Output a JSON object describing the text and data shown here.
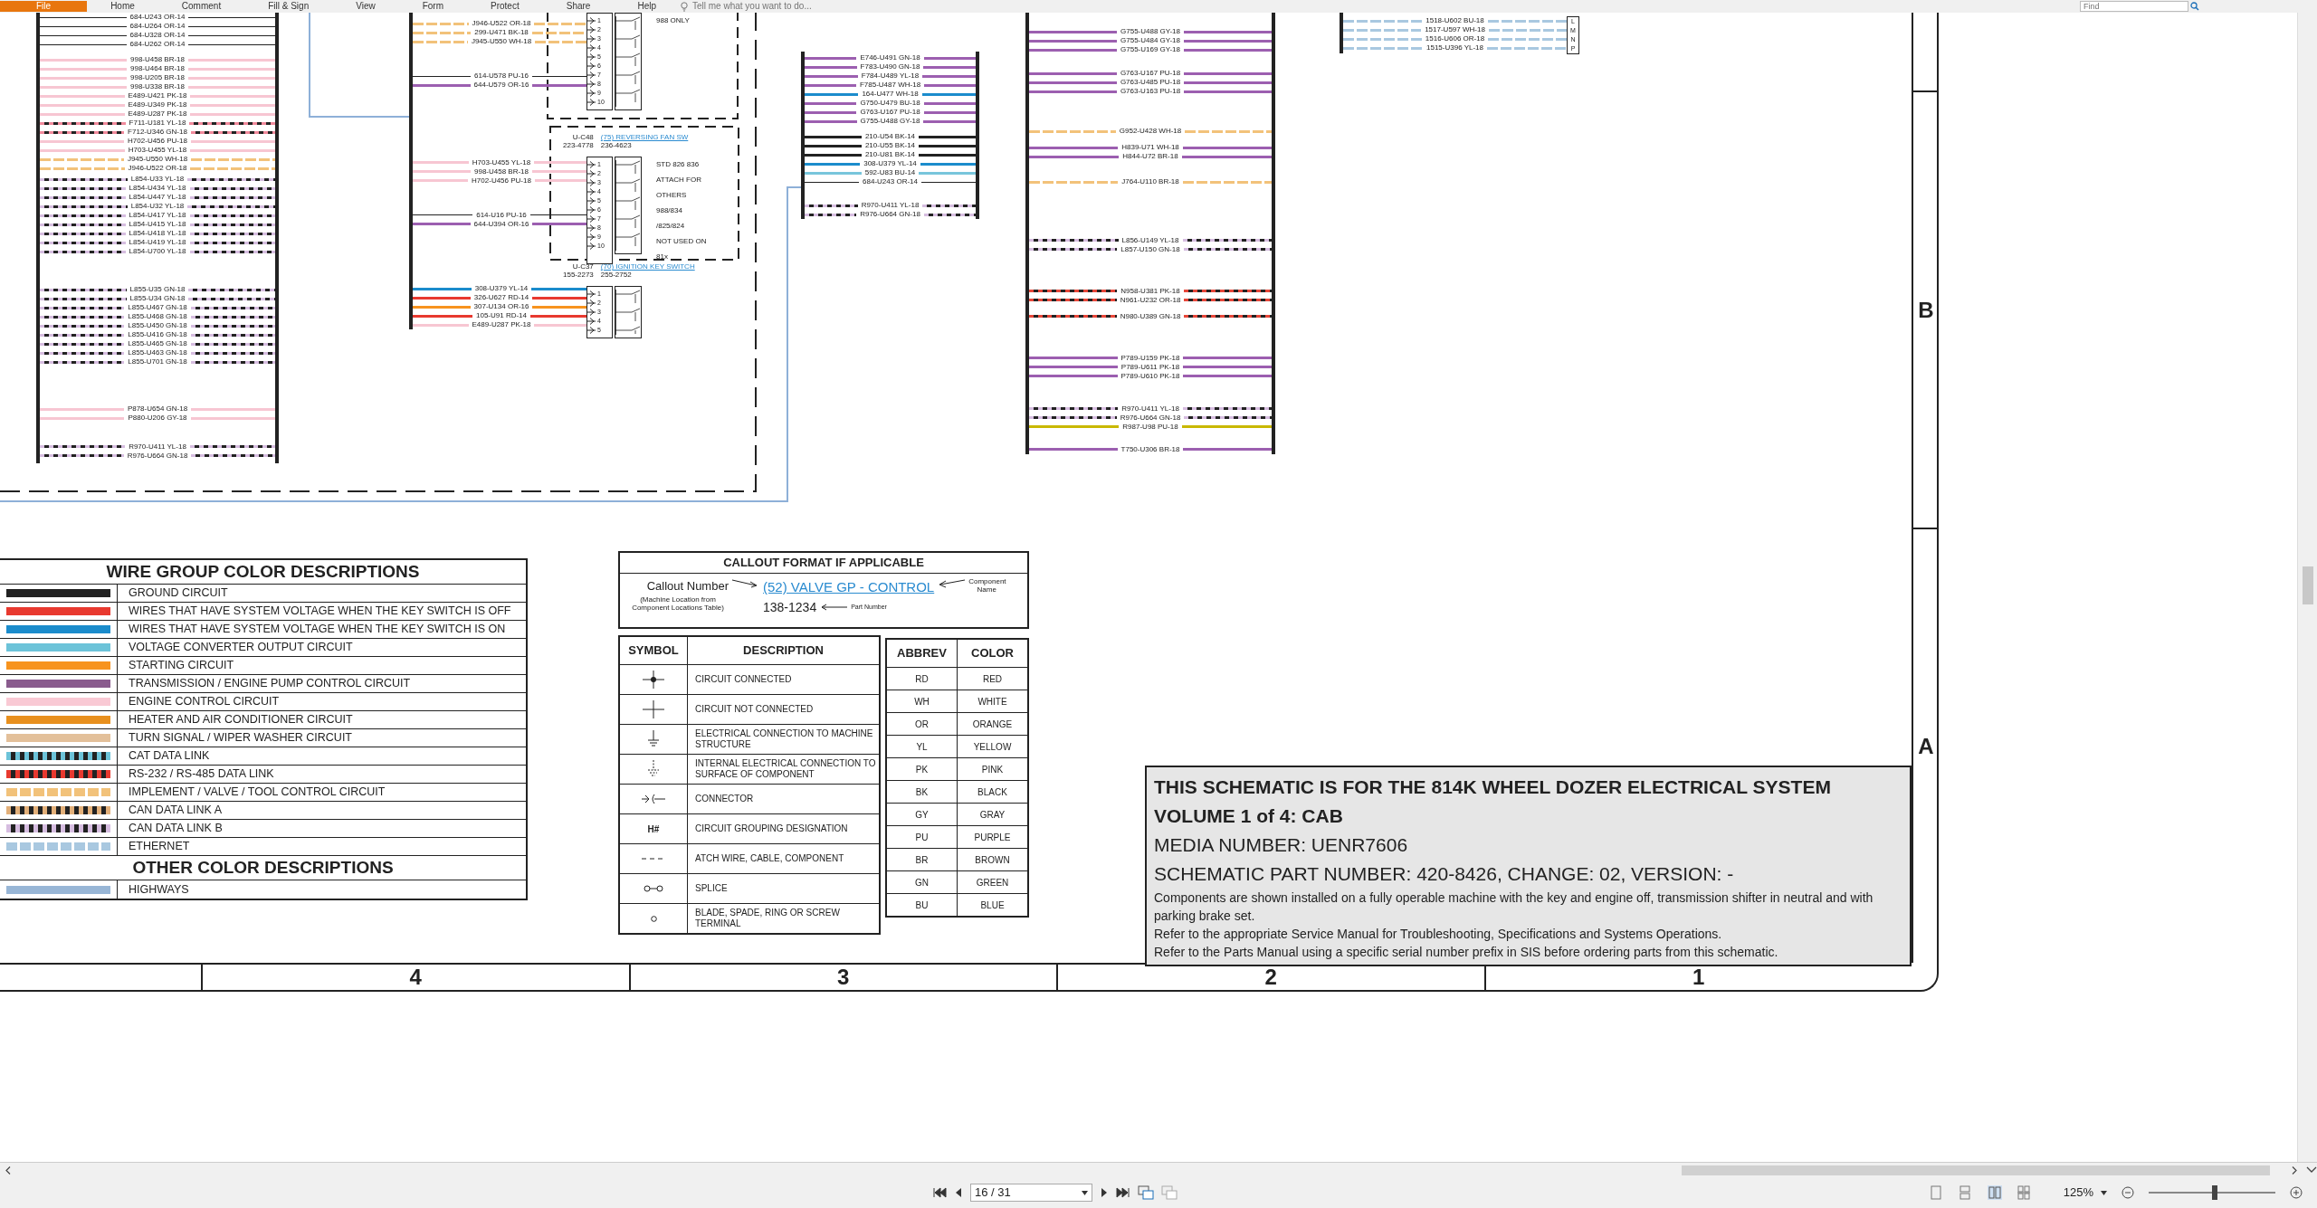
{
  "menu": [
    {
      "label": "File",
      "selected": true
    },
    {
      "label": "Home",
      "selected": false
    },
    {
      "label": "Comment",
      "selected": false
    },
    {
      "label": "Fill & Sign",
      "selected": false
    },
    {
      "label": "View",
      "selected": false
    },
    {
      "label": "Form",
      "selected": false
    },
    {
      "label": "Protect",
      "selected": false
    },
    {
      "label": "Share",
      "selected": false
    },
    {
      "label": "Help",
      "selected": false
    }
  ],
  "tell_me": {
    "placeholder": "Tell me what you want to do..."
  },
  "find": {
    "placeholder": "Find"
  },
  "schematic": {
    "bundles": [
      {
        "groups": [
          {
            "wires": [
              {
                "label": "684-U243 OR-14",
                "kind": "thin",
                "color": "#222222"
              },
              {
                "label": "684-U264 OR-14",
                "kind": "thin",
                "color": "#222222"
              },
              {
                "label": "684-U328 OR-14",
                "kind": "thin",
                "color": "#222222"
              },
              {
                "label": "684-U262 OR-14",
                "kind": "thin",
                "color": "#222222"
              }
            ]
          },
          {
            "wires": [
              {
                "label": "998-U458 BR-18",
                "kind": "solid",
                "color": "#f7c6d2"
              },
              {
                "label": "998-U464 BR-18",
                "kind": "solid",
                "color": "#f7c6d2"
              },
              {
                "label": "998-U205 BR-18",
                "kind": "solid",
                "color": "#f7c6d2"
              },
              {
                "label": "998-U338 BR-18",
                "kind": "solid",
                "color": "#f7c6d2"
              }
            ]
          },
          {
            "wires": [
              {
                "label": "E489-U421 PK-18",
                "kind": "solid",
                "color": "#f7c6d2"
              },
              {
                "label": "E489-U349 PK-18",
                "kind": "solid",
                "color": "#f7c6d2"
              },
              {
                "label": "E489-U287 PK-18",
                "kind": "solid",
                "color": "#f7c6d2"
              }
            ]
          },
          {
            "wires": [
              {
                "label": "F711-U181 YL-18",
                "kind": "striped",
                "color": "#f08a9c"
              },
              {
                "label": "F712-U346 GN-18",
                "kind": "striped",
                "color": "#f08a9c"
              },
              {
                "label": "H702-U456 PU-18",
                "kind": "solid",
                "color": "#f7c6d2"
              },
              {
                "label": "H703-U455 YL-18",
                "kind": "solid",
                "color": "#f7c6d2"
              },
              {
                "label": "J945-U550 WH-18",
                "kind": "banded",
                "color": "#f2c27a"
              },
              {
                "label": "J946-U522 OR-18",
                "kind": "banded",
                "color": "#f2c27a"
              }
            ]
          },
          {
            "wires": [
              {
                "label": "L854-U33 YL-18",
                "kind": "striped",
                "color": "#d6bde0"
              },
              {
                "label": "L854-U434 YL-18",
                "kind": "striped",
                "color": "#d6bde0"
              },
              {
                "label": "L854-U447 YL-18",
                "kind": "striped",
                "color": "#d6bde0"
              },
              {
                "label": "L854-U32 YL-18",
                "kind": "striped",
                "color": "#d6bde0"
              },
              {
                "label": "L854-U417 YL-18",
                "kind": "striped",
                "color": "#d6bde0"
              },
              {
                "label": "L854-U415 YL-18",
                "kind": "striped",
                "color": "#d6bde0"
              },
              {
                "label": "L854-U418 YL-18",
                "kind": "striped",
                "color": "#d6bde0"
              },
              {
                "label": "L854-U419 YL-18",
                "kind": "striped",
                "color": "#d6bde0"
              },
              {
                "label": "L854-U700 YL-18",
                "kind": "striped",
                "color": "#d6bde0"
              }
            ]
          },
          {
            "wires": [
              {
                "label": "L855-U35 GN-18",
                "kind": "striped",
                "color": "#d6bde0"
              },
              {
                "label": "L855-U34 GN-18",
                "kind": "striped",
                "color": "#d6bde0"
              },
              {
                "label": "L855-U467 GN-18",
                "kind": "striped",
                "color": "#d6bde0"
              },
              {
                "label": "L855-U468 GN-18",
                "kind": "striped",
                "color": "#d6bde0"
              },
              {
                "label": "L855-U450 GN-18",
                "kind": "striped",
                "color": "#d6bde0"
              },
              {
                "label": "L855-U416 GN-18",
                "kind": "striped",
                "color": "#d6bde0"
              },
              {
                "label": "L855-U465 GN-18",
                "kind": "striped",
                "color": "#d6bde0"
              },
              {
                "label": "L855-U463 GN-18",
                "kind": "striped",
                "color": "#d6bde0"
              },
              {
                "label": "L855-U701 GN-18",
                "kind": "striped",
                "color": "#d6bde0"
              }
            ]
          },
          {
            "wires": [
              {
                "label": "P878-U654 GN-18",
                "kind": "solid",
                "color": "#f7c6d2"
              },
              {
                "label": "P880-U206 GY-18",
                "kind": "solid",
                "color": "#f7c6d2"
              }
            ]
          },
          {
            "wires": [
              {
                "label": "R970-U411 YL-18",
                "kind": "striped",
                "color": "#d6bde0"
              },
              {
                "label": "R976-U664 GN-18",
                "kind": "striped",
                "color": "#d6bde0"
              }
            ]
          }
        ]
      },
      {
        "groups": [
          {
            "wires": [
              {
                "label": "J946-U522 OR-18",
                "kind": "banded",
                "color": "#f2c27a"
              },
              {
                "label": "299-U471 BK-18",
                "kind": "banded",
                "color": "#f2c27a"
              },
              {
                "label": "J945-U550 WH-18",
                "kind": "banded",
                "color": "#f2c27a"
              }
            ]
          },
          {
            "wires": [
              {
                "label": "614-U578 PU-16",
                "kind": "thin",
                "color": "#222222"
              },
              {
                "label": "644-U579 OR-16",
                "kind": "solid",
                "color": "#9c5fb0"
              }
            ]
          },
          {
            "wires": [
              {
                "label": "H703-U455 YL-18",
                "kind": "solid",
                "color": "#f7c6d2"
              },
              {
                "label": "998-U458 BR-18",
                "kind": "solid",
                "color": "#f7c6d2"
              },
              {
                "label": "H702-U456 PU-18",
                "kind": "solid",
                "color": "#f7c6d2"
              }
            ]
          },
          {
            "wires": [
              {
                "label": "614-U16 PU-16",
                "kind": "thin",
                "color": "#222222"
              },
              {
                "label": "644-U394 OR-16",
                "kind": "solid",
                "color": "#9c5fb0"
              }
            ]
          },
          {
            "wires": [
              {
                "label": "308-U379 YL-14",
                "kind": "solid",
                "color": "#1b8ccc"
              },
              {
                "label": "326-U627 RD-14",
                "kind": "solid",
                "color": "#e8392f"
              },
              {
                "label": "307-U134 OR-16",
                "kind": "solid",
                "color": "#f7931e"
              },
              {
                "label": "105-U91 RD-14",
                "kind": "solid",
                "color": "#e8392f"
              },
              {
                "label": "E489-U287 PK-18",
                "kind": "solid",
                "color": "#f7c6d2"
              }
            ]
          }
        ]
      },
      {
        "groups": [
          {
            "wires": [
              {
                "label": "E746-U491 GN-18",
                "kind": "solid",
                "color": "#9c5fb0"
              },
              {
                "label": "F783-U490 GN-18",
                "kind": "solid",
                "color": "#9c5fb0"
              },
              {
                "label": "F784-U489 YL-18",
                "kind": "solid",
                "color": "#9c5fb0"
              },
              {
                "label": "F785-U487 WH-18",
                "kind": "solid",
                "color": "#9c5fb0"
              },
              {
                "label": "164-U477 WH-18",
                "kind": "solid",
                "color": "#1b8ccc"
              },
              {
                "label": "G750-U479 BU-18",
                "kind": "solid",
                "color": "#9c5fb0"
              },
              {
                "label": "G763-U167 PU-18",
                "kind": "solid",
                "color": "#9c5fb0"
              },
              {
                "label": "G755-U488 GY-18",
                "kind": "solid",
                "color": "#9c5fb0"
              }
            ]
          },
          {
            "wires": [
              {
                "label": "210-U54 BK-14",
                "kind": "solid",
                "color": "#222222"
              },
              {
                "label": "210-U55 BK-14",
                "kind": "solid",
                "color": "#222222"
              },
              {
                "label": "210-U81 BK-14",
                "kind": "solid",
                "color": "#222222"
              },
              {
                "label": "308-U379 YL-14",
                "kind": "solid",
                "color": "#1b8ccc"
              },
              {
                "label": "592-U83 BU-14",
                "kind": "solid",
                "color": "#78c6dc"
              },
              {
                "label": "684-U243 OR-14",
                "kind": "thin",
                "color": "#222222"
              }
            ]
          },
          {
            "wires": [
              {
                "label": "R970-U411 YL-18",
                "kind": "striped",
                "color": "#d6bde0"
              },
              {
                "label": "R976-U664 GN-18",
                "kind": "striped",
                "color": "#d6bde0"
              }
            ]
          }
        ]
      },
      {
        "groups": [
          {
            "wires": [
              {
                "label": "G755-U488 GY-18",
                "kind": "solid",
                "color": "#9c5fb0"
              },
              {
                "label": "G755-U484 GY-18",
                "kind": "solid",
                "color": "#9c5fb0"
              },
              {
                "label": "G755-U169 GY-18",
                "kind": "solid",
                "color": "#9c5fb0"
              }
            ]
          },
          {
            "wires": [
              {
                "label": "G763-U167 PU-18",
                "kind": "solid",
                "color": "#9c5fb0"
              },
              {
                "label": "G763-U485 PU-18",
                "kind": "solid",
                "color": "#9c5fb0"
              },
              {
                "label": "G763-U163 PU-18",
                "kind": "solid",
                "color": "#9c5fb0"
              }
            ]
          },
          {
            "wires": [
              {
                "label": "G952-U428 WH-18",
                "kind": "banded",
                "color": "#f2c27a"
              }
            ]
          },
          {
            "wires": [
              {
                "label": "H839-U71 WH-18",
                "kind": "solid",
                "color": "#9c5fb0"
              },
              {
                "label": "H844-U72 BR-18",
                "kind": "solid",
                "color": "#9c5fb0"
              }
            ]
          },
          {
            "wires": [
              {
                "label": "J764-U110 BR-18",
                "kind": "banded",
                "color": "#f2c27a"
              }
            ]
          },
          {
            "wires": [
              {
                "label": "L856-U149 YL-18",
                "kind": "striped",
                "color": "#d6bde0"
              },
              {
                "label": "L857-U150 GN-18",
                "kind": "striped",
                "color": "#d6bde0"
              }
            ]
          },
          {
            "wires": [
              {
                "label": "N958-U381 PK-18",
                "kind": "striped",
                "color": "#e8473a"
              },
              {
                "label": "N961-U232 OR-18",
                "kind": "striped",
                "color": "#e8473a"
              }
            ]
          },
          {
            "wires": [
              {
                "label": "N980-U389 GN-18",
                "kind": "striped",
                "color": "#e8473a"
              }
            ]
          },
          {
            "wires": [
              {
                "label": "P789-U159 PK-18",
                "kind": "solid",
                "color": "#9c5fb0"
              },
              {
                "label": "P789-U611 PK-18",
                "kind": "solid",
                "color": "#9c5fb0"
              },
              {
                "label": "P789-U610 PK-18",
                "kind": "solid",
                "color": "#9c5fb0"
              }
            ]
          },
          {
            "wires": [
              {
                "label": "R970-U411 YL-18",
                "kind": "striped",
                "color": "#d6bde0"
              },
              {
                "label": "R976-U664 GN-18",
                "kind": "striped",
                "color": "#d6bde0"
              },
              {
                "label": "R987-U98 PU-18",
                "kind": "solid",
                "color": "#c9b800"
              }
            ]
          },
          {
            "wires": [
              {
                "label": "T750-U306 BR-18",
                "kind": "solid",
                "color": "#9c5fb0"
              }
            ]
          }
        ]
      },
      {
        "connector_pins": [
          "L",
          "M",
          "N",
          "P"
        ],
        "groups": [
          {
            "wires": [
              {
                "label": "1518-U602 BU-18",
                "kind": "banded",
                "color": "#a9c8e0"
              },
              {
                "label": "1517-U597 WH-18",
                "kind": "banded",
                "color": "#a9c8e0"
              },
              {
                "label": "1516-U606 OR-18",
                "kind": "banded",
                "color": "#a9c8e0"
              },
              {
                "label": "1515-U396 YL-18",
                "kind": "banded",
                "color": "#a9c8e0"
              }
            ]
          }
        ]
      }
    ],
    "components": [
      {
        "pins": [
          "1",
          "2",
          "3",
          "4",
          "5",
          "6",
          "7",
          "8",
          "9",
          "10"
        ],
        "notes": [
          "988 ONLY"
        ]
      },
      {
        "ref": "U-C48",
        "ref_number": "223-4778",
        "callout": "(75) REVERSING FAN SW",
        "part_number": "236-4623",
        "pins": [
          "1",
          "2",
          "3",
          "4",
          "5",
          "6",
          "7",
          "8",
          "9",
          "10"
        ],
        "notes": [
          "STD 826 836",
          "ATTACH FOR",
          "OTHERS",
          "988/834",
          "/825/824",
          "NOT USED ON",
          "81x"
        ]
      },
      {
        "ref": "U-C37",
        "ref_number": "155-2273",
        "callout": "(70) IGNITION KEY SWITCH",
        "part_number": "255-2752",
        "pins": [
          "1",
          "2",
          "3",
          "4",
          "5"
        ]
      }
    ],
    "zones": [
      "B",
      "A"
    ],
    "columns": [
      "4",
      "3",
      "2",
      "1"
    ]
  },
  "wire_legend": {
    "title": "WIRE GROUP COLOR DESCRIPTIONS",
    "rows": [
      {
        "label": "GROUND CIRCUIT",
        "kind": "solid",
        "color": "#222222"
      },
      {
        "label": "WIRES THAT HAVE SYSTEM VOLTAGE WHEN THE KEY SWITCH IS OFF",
        "kind": "solid",
        "color": "#e8392f"
      },
      {
        "label": "WIRES THAT HAVE SYSTEM VOLTAGE WHEN THE KEY SWITCH IS ON",
        "kind": "solid",
        "color": "#1b8ccc"
      },
      {
        "label": "VOLTAGE CONVERTER OUTPUT CIRCUIT",
        "kind": "solid",
        "color": "#6cc3d9"
      },
      {
        "label": "STARTING CIRCUIT",
        "kind": "solid",
        "color": "#f7931e"
      },
      {
        "label": "TRANSMISSION / ENGINE PUMP CONTROL CIRCUIT",
        "kind": "solid",
        "color": "#8a5c8e"
      },
      {
        "label": "ENGINE CONTROL CIRCUIT",
        "kind": "solid",
        "color": "#f9c9d4"
      },
      {
        "label": "HEATER AND AIR CONDITIONER CIRCUIT",
        "kind": "solid",
        "color": "#e8901e"
      },
      {
        "label": "TURN SIGNAL / WIPER WASHER CIRCUIT",
        "kind": "solid",
        "color": "#e3c09a"
      },
      {
        "label": "CAT DATA LINK",
        "kind": "striped",
        "color": "#6cc3d9"
      },
      {
        "label": "RS-232 / RS-485 DATA LINK",
        "kind": "striped",
        "color": "#e8392f"
      },
      {
        "label": "IMPLEMENT / VALVE / TOOL CONTROL CIRCUIT",
        "kind": "banded",
        "color": "#f2c27a"
      },
      {
        "label": "CAN DATA LINK A",
        "kind": "striped",
        "color": "#e3b07a"
      },
      {
        "label": "CAN DATA LINK B",
        "kind": "striped",
        "color": "#d6bde0"
      },
      {
        "label": "ETHERNET",
        "kind": "banded",
        "color": "#a9c8e0"
      }
    ],
    "other_title": "OTHER COLOR DESCRIPTIONS",
    "other_rows": [
      {
        "label": "HIGHWAYS",
        "kind": "solid",
        "color": "#98b6d6"
      }
    ]
  },
  "callout_format": {
    "title": "CALLOUT FORMAT IF APPLICABLE",
    "callout_number": "Callout Number",
    "location_note": "(Machine Location from Component Locations Table)",
    "callout_example": "(52) VALVE GP - CONTROL",
    "component_name": "Component Name",
    "part_number_example": "138-1234",
    "part_number_label": "Part Number"
  },
  "symbols": {
    "columns": [
      "SYMBOL",
      "DESCRIPTION"
    ],
    "rows": [
      {
        "kind": "connected",
        "description": "CIRCUIT CONNECTED"
      },
      {
        "kind": "not_connected",
        "description": "CIRCUIT NOT CONNECTED"
      },
      {
        "kind": "ground",
        "description": "ELECTRICAL CONNECTION TO MACHINE STRUCTURE"
      },
      {
        "kind": "internal_ground",
        "description": "INTERNAL ELECTRICAL CONNECTION TO SURFACE OF COMPONENT"
      },
      {
        "kind": "connector",
        "description": "CONNECTOR"
      },
      {
        "kind": "text",
        "symbol": "H#",
        "description": "CIRCUIT GROUPING DESIGNATION"
      },
      {
        "kind": "dashed",
        "description": "ATCH WIRE, CABLE, COMPONENT"
      },
      {
        "kind": "splice",
        "description": "SPLICE"
      },
      {
        "kind": "terminal",
        "description": "BLADE, SPADE, RING OR SCREW TERMINAL"
      }
    ]
  },
  "abbreviations": {
    "columns": [
      "ABBREV",
      "COLOR"
    ],
    "rows": [
      {
        "abbrev": "RD",
        "name": "RED"
      },
      {
        "abbrev": "WH",
        "name": "WHITE"
      },
      {
        "abbrev": "OR",
        "name": "ORANGE"
      },
      {
        "abbrev": "YL",
        "name": "YELLOW"
      },
      {
        "abbrev": "PK",
        "name": "PINK"
      },
      {
        "abbrev": "BK",
        "name": "BLACK"
      },
      {
        "abbrev": "GY",
        "name": "GRAY"
      },
      {
        "abbrev": "PU",
        "name": "PURPLE"
      },
      {
        "abbrev": "BR",
        "name": "BROWN"
      },
      {
        "abbrev": "GN",
        "name": "GREEN"
      },
      {
        "abbrev": "BU",
        "name": "BLUE"
      }
    ]
  },
  "title_block": {
    "heading": "THIS SCHEMATIC IS FOR THE 814K WHEEL DOZER ELECTRICAL SYSTEM",
    "volume": "VOLUME 1 of 4: CAB",
    "media": "MEDIA NUMBER: UENR7606",
    "part": "SCHEMATIC PART NUMBER: 420-8426, CHANGE: 02, VERSION: -",
    "notes": [
      "Components are shown installed on a fully operable machine with the key and engine off, transmission shifter in neutral and with parking brake set.",
      "Refer to the appropriate Service Manual for Troubleshooting, Specifications and Systems Operations.",
      "Refer to the Parts Manual using a specific serial number prefix in SIS before ordering parts from this schematic."
    ]
  },
  "viewer": {
    "page": "16 / 31",
    "zoom": "125%",
    "zoom_slider": {
      "level": 0.52
    }
  }
}
